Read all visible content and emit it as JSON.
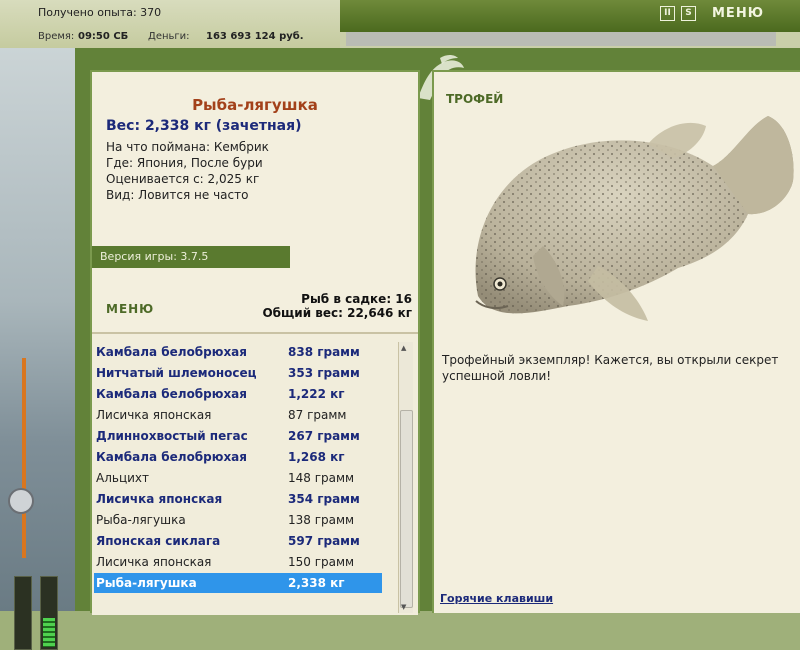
{
  "hud": {
    "experience": "Получено опыта: 370",
    "time_label": "Время:",
    "time_value": "09:50 СБ",
    "money_label": "Деньги:",
    "money_value": "163 693 124 руб.",
    "menu_label": "МЕНЮ",
    "pause_icon": "pause-icon",
    "sound_icon": "sound-icon"
  },
  "fish_card": {
    "name": "Рыба-лягушка",
    "weight": "Вес: 2,338 кг (зачетная)",
    "bait": "На что поймана: Кембрик",
    "location": "Где: Япония, После бури",
    "value": "Оценивается с: 2,025 кг",
    "rarity": "Вид: Ловится не часто"
  },
  "version": "Версия игры: 3.7.5",
  "menu_link": "МЕНЮ",
  "keepnet": {
    "count": "Рыб в садке: 16",
    "total_weight": "Общий вес: 22,646 кг"
  },
  "catch_list": [
    {
      "name": "Камбала белобрюхая",
      "weight": "838 грамм",
      "style": "b"
    },
    {
      "name": "Нитчатый шлемоносец",
      "weight": "353 грамм",
      "style": "b"
    },
    {
      "name": "Камбала белобрюхая",
      "weight": "1,222 кг",
      "style": "b"
    },
    {
      "name": "Лисичка японская",
      "weight": "87 грамм",
      "style": "r"
    },
    {
      "name": "Длиннохвостый пегас",
      "weight": "267 грамм",
      "style": "b"
    },
    {
      "name": "Камбала белобрюхая",
      "weight": "1,268 кг",
      "style": "b"
    },
    {
      "name": "Альцихт",
      "weight": "148 грамм",
      "style": "r"
    },
    {
      "name": "Лисичка японская",
      "weight": "354 грамм",
      "style": "b"
    },
    {
      "name": "Рыба-лягушка",
      "weight": "138 грамм",
      "style": "r"
    },
    {
      "name": "Японская сиклага",
      "weight": "597 грамм",
      "style": "b"
    },
    {
      "name": "Лисичка японская",
      "weight": "150 грамм",
      "style": "r"
    },
    {
      "name": "Рыба-лягушка",
      "weight": "2,338 кг",
      "style": "sel"
    }
  ],
  "trophy": {
    "label": "ТРОФЕЙ",
    "description": "Трофейный экземпляр! Кажется, вы открыли секрет успешной ловли!",
    "hotkeys": "Горячие клавиши"
  },
  "colors": {
    "selected_row": "#2f95ea",
    "bold_entry": "#1c2a7a",
    "fish_name": "#a3411a",
    "frame_green": "#628239"
  }
}
